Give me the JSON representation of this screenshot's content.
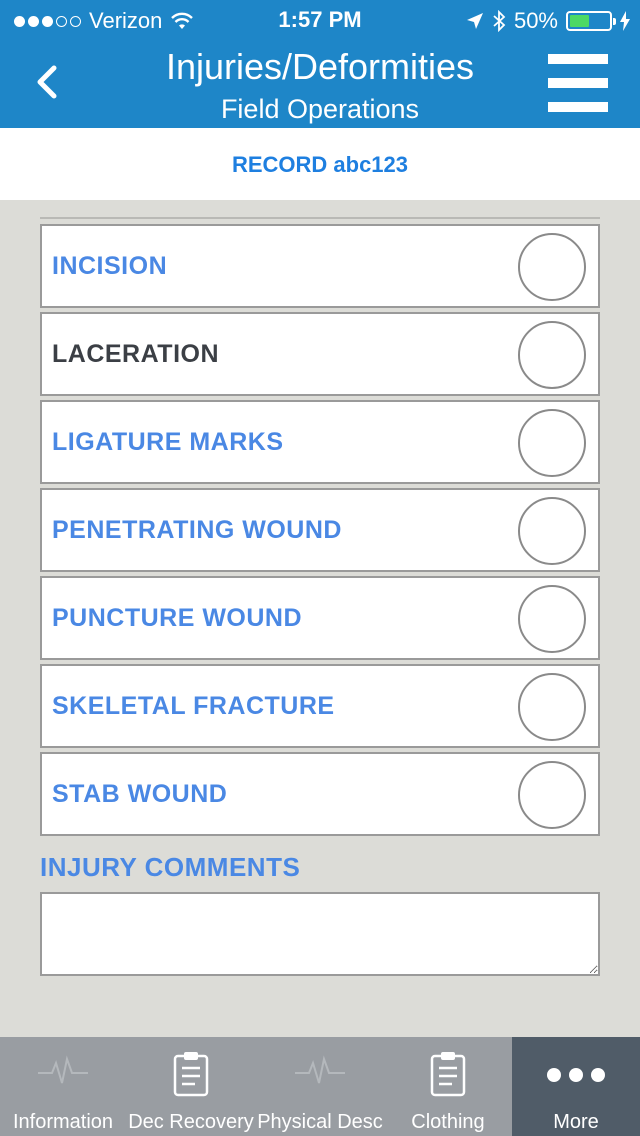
{
  "status_bar": {
    "carrier": "Verizon",
    "time": "1:57 PM",
    "battery": "50%",
    "battery_level": 0.5,
    "battery_color": "#4cd964"
  },
  "header": {
    "title": "Injuries/Deformities",
    "subtitle": "Field Operations",
    "back_icon": "chevron-left-icon",
    "menu_icon": "hamburger-menu-icon",
    "bg_color": "#1e86c8"
  },
  "record": {
    "label": "RECORD abc123"
  },
  "injuries": [
    {
      "label": "INCISION",
      "checked": false
    },
    {
      "label": "LACERATION",
      "checked": false
    },
    {
      "label": "LIGATURE MARKS",
      "checked": false
    },
    {
      "label": "PENETRATING WOUND",
      "checked": false
    },
    {
      "label": "PUNCTURE WOUND",
      "checked": false
    },
    {
      "label": "SKELETAL FRACTURE",
      "checked": false
    },
    {
      "label": "STAB WOUND",
      "checked": false
    }
  ],
  "comments": {
    "label": "INJURY COMMENTS",
    "value": ""
  },
  "tabs": [
    {
      "label": "Information",
      "icon": "heartbeat-icon",
      "active": false
    },
    {
      "label": "Dec Recovery",
      "icon": "clipboard-icon",
      "active": false
    },
    {
      "label": "Physical Desc",
      "icon": "heartbeat-icon",
      "active": false
    },
    {
      "label": "Clothing",
      "icon": "clipboard-icon",
      "active": false
    },
    {
      "label": "More",
      "icon": "more-dots-icon",
      "active": true
    }
  ]
}
